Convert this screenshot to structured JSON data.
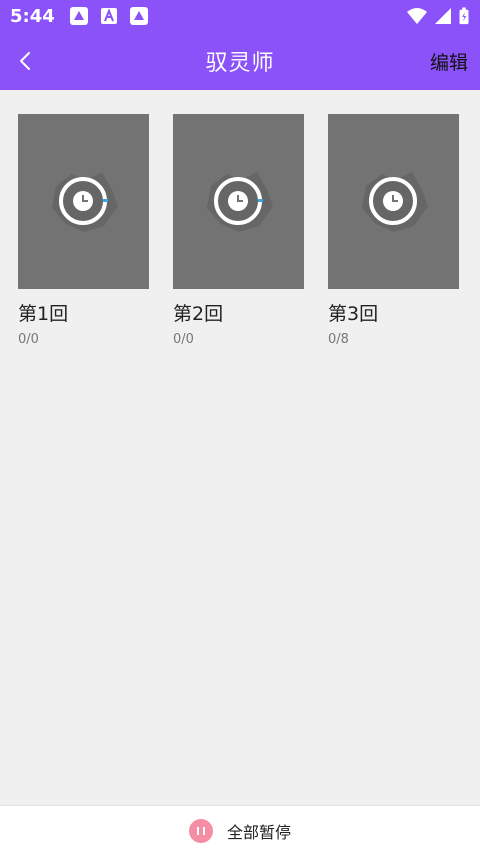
{
  "status": {
    "time": "5:44",
    "notification_icons": [
      "app-icon",
      "a-icon",
      "app-icon"
    ],
    "right_icons": [
      "wifi-icon",
      "signal-icon",
      "battery-icon"
    ]
  },
  "header": {
    "title": "驭灵师",
    "edit_label": "编辑"
  },
  "episodes": [
    {
      "title": "第1回",
      "progress": "0/0",
      "ring_marker": true
    },
    {
      "title": "第2回",
      "progress": "0/0",
      "ring_marker": true
    },
    {
      "title": "第3回",
      "progress": "0/8",
      "ring_marker": false
    }
  ],
  "footer": {
    "pause_all_label": "全部暂停"
  },
  "colors": {
    "accent": "#8a52f8",
    "pause": "#f58da5",
    "progress_marker": "#34a6e8"
  }
}
